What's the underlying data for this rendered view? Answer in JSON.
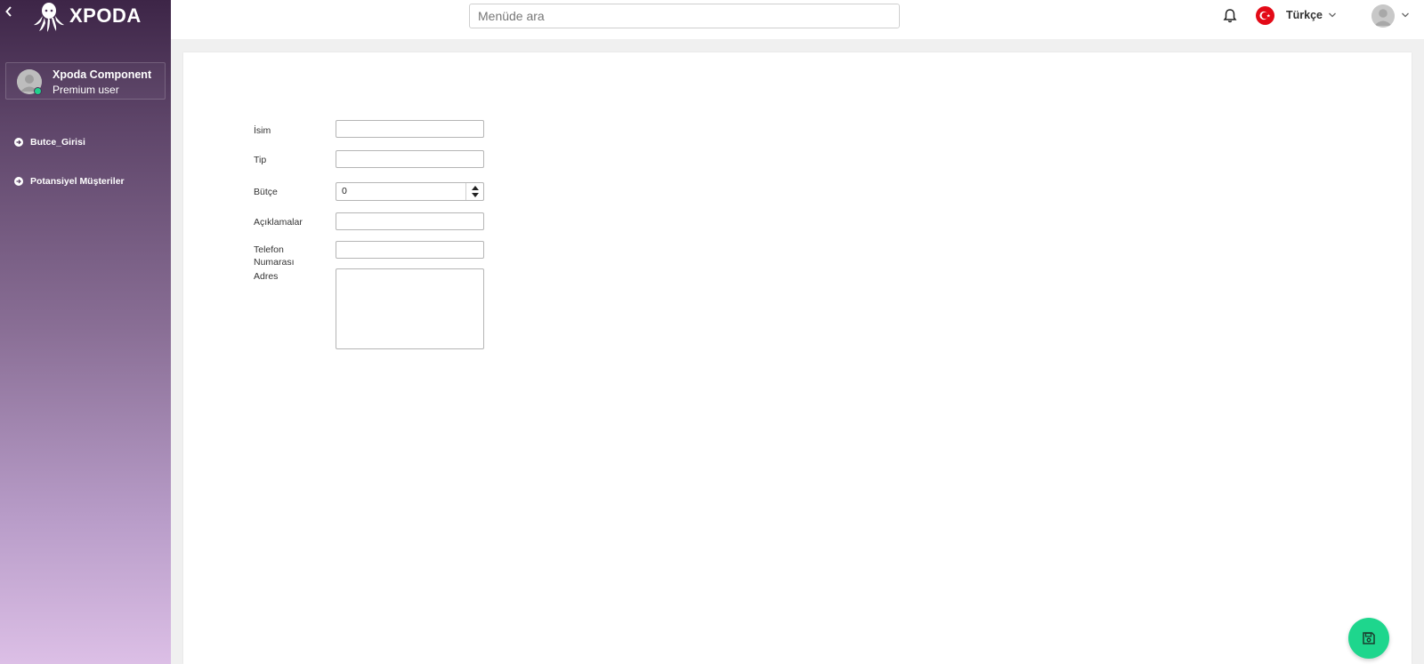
{
  "app": {
    "logo_text": "XPODA"
  },
  "user": {
    "name": "Xpoda Component",
    "role": "Premium user"
  },
  "sidebar": {
    "items": [
      {
        "label": "Butce_Girisi"
      },
      {
        "label": "Potansiyel Müşteriler"
      }
    ]
  },
  "search": {
    "placeholder": "Menüde ara",
    "value": ""
  },
  "topbar": {
    "language": "Türkçe"
  },
  "form": {
    "fields": [
      {
        "label": "İsim",
        "value": ""
      },
      {
        "label": "Tip",
        "value": ""
      },
      {
        "label": "Bütçe",
        "value": "0"
      },
      {
        "label": "Açıklamalar",
        "value": ""
      },
      {
        "label": "Telefon Numarası",
        "value": ""
      },
      {
        "label": "Adres",
        "value": ""
      }
    ]
  },
  "colors": {
    "sidebar_top": "#3d2547",
    "sidebar_bottom": "#dcbfe6",
    "accent_green": "#1ed68d",
    "status_online": "#1fd28c",
    "flag_red": "#e30a17"
  },
  "icons": {
    "collapse": "chevron-left-icon",
    "logo": "octopus-logo-icon",
    "nav": "arrow-circle-right-icon",
    "notification": "bell-icon",
    "language_flag": "turkey-flag-icon",
    "dropdown": "chevron-down-icon",
    "save": "floppy-disk-icon"
  }
}
